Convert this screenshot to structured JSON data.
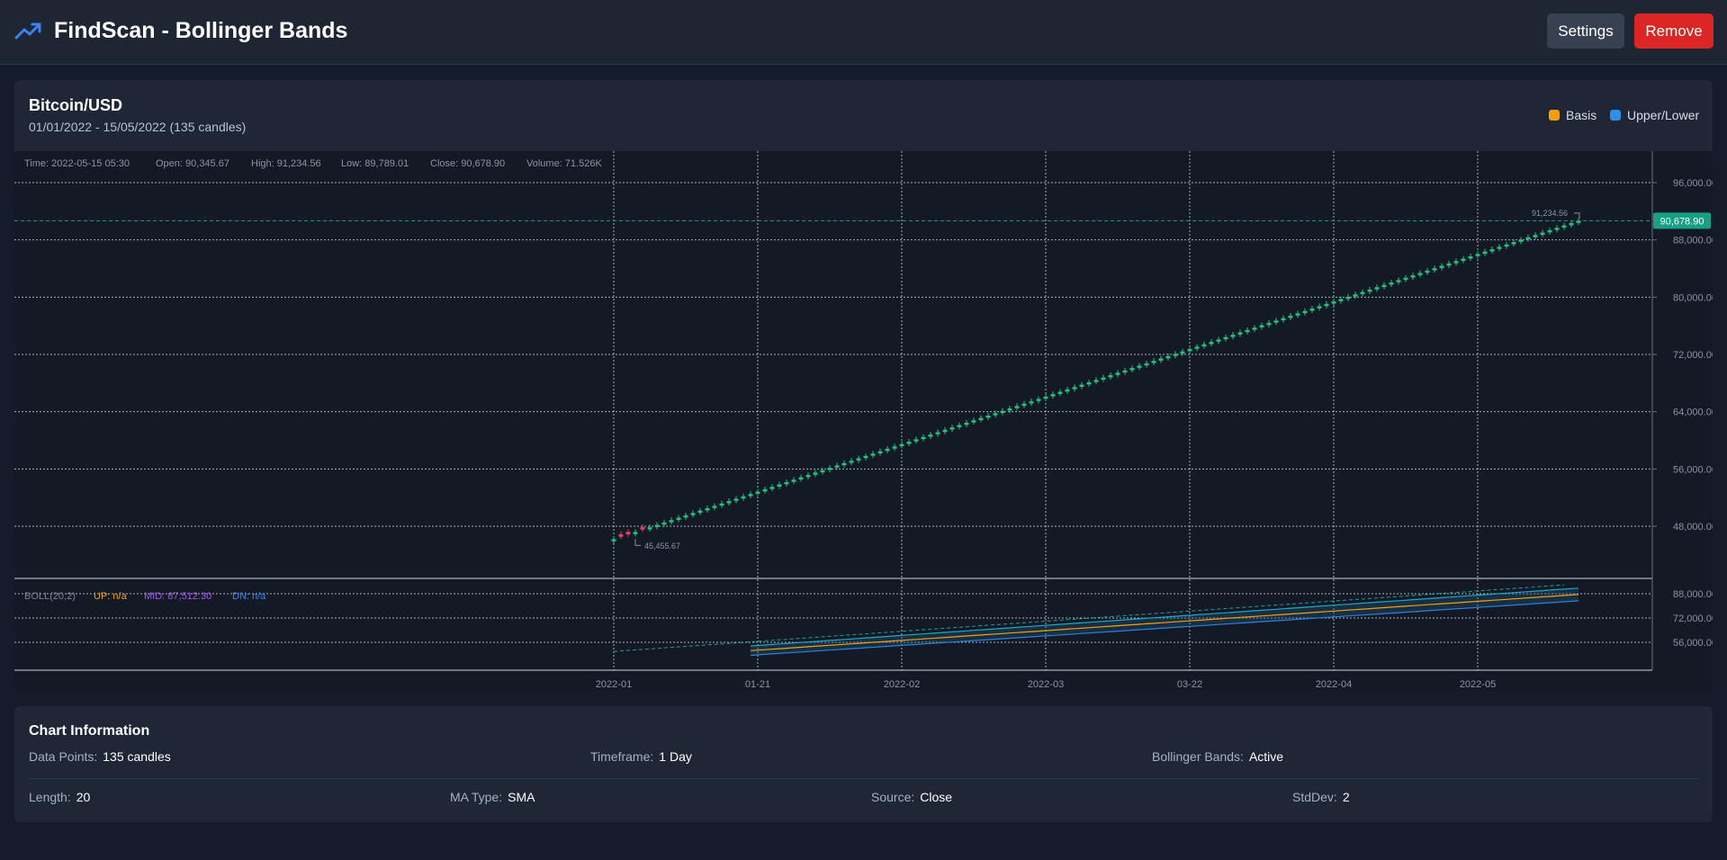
{
  "header": {
    "title": "FindScan - Bollinger Bands",
    "settings_label": "Settings",
    "remove_label": "Remove",
    "logo_icon": "trending-up-icon",
    "accent": "#3b82f6",
    "remove_color": "#dc2626"
  },
  "chart": {
    "pair": "Bitcoin/USD",
    "range": "01/01/2022 - 15/05/2022 (135 candles)",
    "legend": [
      {
        "label": "Basis",
        "color": "#f59e0b"
      },
      {
        "label": "Upper/Lower",
        "color": "#3b82f6"
      }
    ],
    "ohlc": {
      "time": "Time: 2022-05-15 05:30",
      "open": "Open: 90,345.67",
      "high": "High: 91,234.56",
      "low": "Low: 89,789.01",
      "close": "Close: 90,678.90",
      "volume": "Volume: 71.526K"
    },
    "last_price_label": "90,678.90",
    "max_label": "91,234.56",
    "min_label": "45,455.67",
    "boll": {
      "name": "BOLL(20,2)",
      "up": "UP: n/a",
      "mid": "MID: 87,512.30",
      "dn": "DN: n/a"
    }
  },
  "chart_data": {
    "type": "candlestick",
    "title": "Bitcoin/USD",
    "candles": 135,
    "x_ticks": [
      "2022-01",
      "01-21",
      "2022-02",
      "2022-03",
      "03-22",
      "2022-04",
      "2022-05"
    ],
    "y_ticks": [
      "96,000.00",
      "88,000.00",
      "80,000.00",
      "72,000.00",
      "64,000.00",
      "56,000.00",
      "48,000.00"
    ],
    "indicator_y_ticks": [
      "88,000.00",
      "72,000.00",
      "56,000.00"
    ],
    "ylim": [
      41000,
      100000
    ],
    "indicator_ylim": [
      48000,
      95000
    ],
    "close_start": 46200,
    "close_end": 90678.9,
    "high_max": 91234.56,
    "low_min": 45455.67,
    "last_close": 90678.9,
    "boll_basis_start": 50500,
    "boll_basis_end": 87512.3,
    "boll_band_half_width_start": 1400,
    "boll_band_half_width_end": 1900,
    "colors": {
      "up": "#26c281",
      "down": "#e0436b",
      "basis": "#f59e0b",
      "band": "#2f7fd8",
      "band_fill": "#1f5a7a",
      "last_price": "#16a085"
    }
  },
  "info": {
    "title": "Chart Information",
    "row1": [
      {
        "k": "Data Points:",
        "v": "135 candles"
      },
      {
        "k": "Timeframe:",
        "v": "1 Day"
      },
      {
        "k": "Bollinger Bands:",
        "v": "Active"
      }
    ],
    "row2": [
      {
        "k": "Length:",
        "v": "20"
      },
      {
        "k": "MA Type:",
        "v": "SMA"
      },
      {
        "k": "Source:",
        "v": "Close"
      },
      {
        "k": "StdDev:",
        "v": "2"
      }
    ]
  }
}
